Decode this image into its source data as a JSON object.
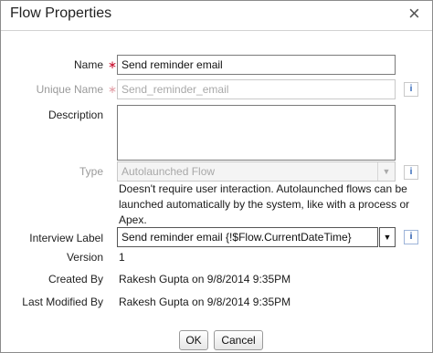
{
  "dialog": {
    "title": "Flow Properties",
    "close_glyph": "×",
    "required_glyph": "∗",
    "help_glyph": "i"
  },
  "fields": {
    "name": {
      "label": "Name",
      "value": "Send reminder email"
    },
    "unique_name": {
      "label": "Unique Name",
      "value": "Send_reminder_email"
    },
    "description": {
      "label": "Description",
      "value": ""
    },
    "type": {
      "label": "Type",
      "value": "Autolaunched Flow",
      "help_text": "Doesn't require user interaction. Autolaunched flows can be launched automatically by the system, like with a process or Apex."
    },
    "interview_label": {
      "label": "Interview Label",
      "value": "Send reminder email {!$Flow.CurrentDateTime}"
    },
    "version": {
      "label": "Version",
      "value": "1"
    },
    "created_by": {
      "label": "Created By",
      "value": "Rakesh Gupta on 9/8/2014 9:35PM"
    },
    "last_modified_by": {
      "label": "Last Modified By",
      "value": "Rakesh Gupta on 9/8/2014 9:35PM"
    }
  },
  "buttons": {
    "ok": "OK",
    "cancel": "Cancel"
  },
  "icons": {
    "close": "close-icon",
    "required": "required-asterisk-icon",
    "help": "info-icon",
    "dropdown": "chevron-down-icon"
  },
  "colors": {
    "required": "#c8102e",
    "help": "#2e64b8",
    "disabled_text": "#a8a8a8"
  }
}
